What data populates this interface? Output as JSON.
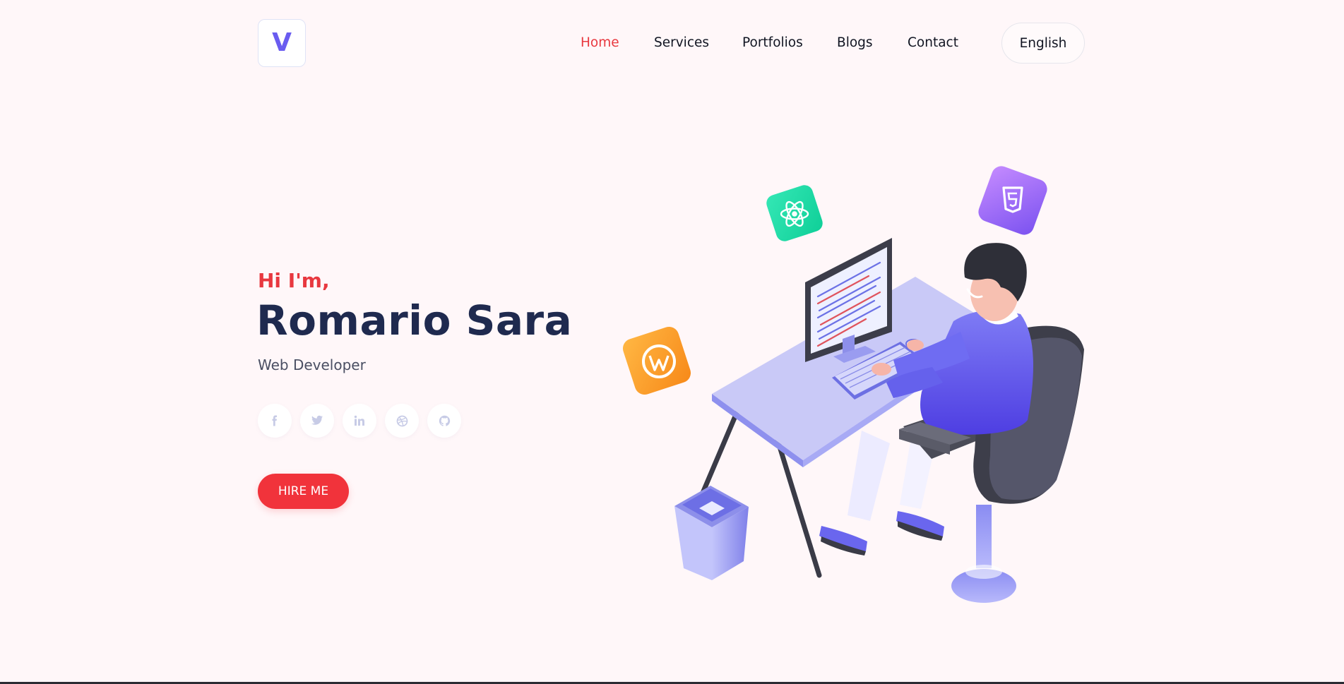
{
  "logo": {
    "letter": "V"
  },
  "nav": {
    "items": [
      {
        "label": "Home",
        "active": true
      },
      {
        "label": "Services",
        "active": false
      },
      {
        "label": "Portfolios",
        "active": false
      },
      {
        "label": "Blogs",
        "active": false
      },
      {
        "label": "Contact",
        "active": false
      }
    ],
    "language": "English"
  },
  "hero": {
    "greeting": "Hi I'm,",
    "name": "Romario Sara",
    "role": "Web Developer",
    "cta": "HIRE ME"
  },
  "socials": [
    "facebook-icon",
    "twitter-icon",
    "linkedin-icon",
    "dribbble-icon",
    "github-icon"
  ],
  "colors": {
    "background": "#fff7f9",
    "accent": "#f1333b",
    "logo": "#6a5cf0",
    "heading": "#1f2a4f"
  }
}
